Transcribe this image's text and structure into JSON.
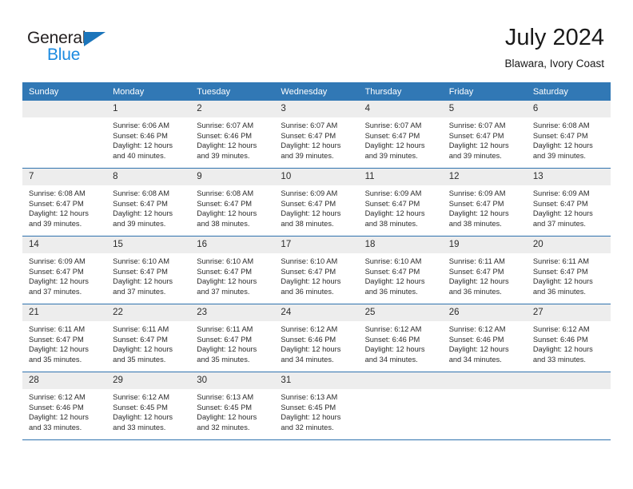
{
  "brand": {
    "name_top": "General",
    "name_bottom": "Blue",
    "color_dark": "#231f20",
    "color_blue": "#1b8ae0",
    "triangle_color": "#1b75bb"
  },
  "header": {
    "month_title": "July 2024",
    "location": "Blawara, Ivory Coast"
  },
  "theme": {
    "header_blue": "#3178b5",
    "rule_blue": "#2f72ae",
    "daynum_bg": "#ededed",
    "text": "#2b2b2b"
  },
  "weekday_headers": [
    "Sunday",
    "Monday",
    "Tuesday",
    "Wednesday",
    "Thursday",
    "Friday",
    "Saturday"
  ],
  "weeks": [
    [
      {
        "day": "",
        "sunrise": "",
        "sunset": "",
        "daylight": ""
      },
      {
        "day": "1",
        "sunrise": "Sunrise: 6:06 AM",
        "sunset": "Sunset: 6:46 PM",
        "daylight": "Daylight: 12 hours and 40 minutes."
      },
      {
        "day": "2",
        "sunrise": "Sunrise: 6:07 AM",
        "sunset": "Sunset: 6:46 PM",
        "daylight": "Daylight: 12 hours and 39 minutes."
      },
      {
        "day": "3",
        "sunrise": "Sunrise: 6:07 AM",
        "sunset": "Sunset: 6:47 PM",
        "daylight": "Daylight: 12 hours and 39 minutes."
      },
      {
        "day": "4",
        "sunrise": "Sunrise: 6:07 AM",
        "sunset": "Sunset: 6:47 PM",
        "daylight": "Daylight: 12 hours and 39 minutes."
      },
      {
        "day": "5",
        "sunrise": "Sunrise: 6:07 AM",
        "sunset": "Sunset: 6:47 PM",
        "daylight": "Daylight: 12 hours and 39 minutes."
      },
      {
        "day": "6",
        "sunrise": "Sunrise: 6:08 AM",
        "sunset": "Sunset: 6:47 PM",
        "daylight": "Daylight: 12 hours and 39 minutes."
      }
    ],
    [
      {
        "day": "7",
        "sunrise": "Sunrise: 6:08 AM",
        "sunset": "Sunset: 6:47 PM",
        "daylight": "Daylight: 12 hours and 39 minutes."
      },
      {
        "day": "8",
        "sunrise": "Sunrise: 6:08 AM",
        "sunset": "Sunset: 6:47 PM",
        "daylight": "Daylight: 12 hours and 39 minutes."
      },
      {
        "day": "9",
        "sunrise": "Sunrise: 6:08 AM",
        "sunset": "Sunset: 6:47 PM",
        "daylight": "Daylight: 12 hours and 38 minutes."
      },
      {
        "day": "10",
        "sunrise": "Sunrise: 6:09 AM",
        "sunset": "Sunset: 6:47 PM",
        "daylight": "Daylight: 12 hours and 38 minutes."
      },
      {
        "day": "11",
        "sunrise": "Sunrise: 6:09 AM",
        "sunset": "Sunset: 6:47 PM",
        "daylight": "Daylight: 12 hours and 38 minutes."
      },
      {
        "day": "12",
        "sunrise": "Sunrise: 6:09 AM",
        "sunset": "Sunset: 6:47 PM",
        "daylight": "Daylight: 12 hours and 38 minutes."
      },
      {
        "day": "13",
        "sunrise": "Sunrise: 6:09 AM",
        "sunset": "Sunset: 6:47 PM",
        "daylight": "Daylight: 12 hours and 37 minutes."
      }
    ],
    [
      {
        "day": "14",
        "sunrise": "Sunrise: 6:09 AM",
        "sunset": "Sunset: 6:47 PM",
        "daylight": "Daylight: 12 hours and 37 minutes."
      },
      {
        "day": "15",
        "sunrise": "Sunrise: 6:10 AM",
        "sunset": "Sunset: 6:47 PM",
        "daylight": "Daylight: 12 hours and 37 minutes."
      },
      {
        "day": "16",
        "sunrise": "Sunrise: 6:10 AM",
        "sunset": "Sunset: 6:47 PM",
        "daylight": "Daylight: 12 hours and 37 minutes."
      },
      {
        "day": "17",
        "sunrise": "Sunrise: 6:10 AM",
        "sunset": "Sunset: 6:47 PM",
        "daylight": "Daylight: 12 hours and 36 minutes."
      },
      {
        "day": "18",
        "sunrise": "Sunrise: 6:10 AM",
        "sunset": "Sunset: 6:47 PM",
        "daylight": "Daylight: 12 hours and 36 minutes."
      },
      {
        "day": "19",
        "sunrise": "Sunrise: 6:11 AM",
        "sunset": "Sunset: 6:47 PM",
        "daylight": "Daylight: 12 hours and 36 minutes."
      },
      {
        "day": "20",
        "sunrise": "Sunrise: 6:11 AM",
        "sunset": "Sunset: 6:47 PM",
        "daylight": "Daylight: 12 hours and 36 minutes."
      }
    ],
    [
      {
        "day": "21",
        "sunrise": "Sunrise: 6:11 AM",
        "sunset": "Sunset: 6:47 PM",
        "daylight": "Daylight: 12 hours and 35 minutes."
      },
      {
        "day": "22",
        "sunrise": "Sunrise: 6:11 AM",
        "sunset": "Sunset: 6:47 PM",
        "daylight": "Daylight: 12 hours and 35 minutes."
      },
      {
        "day": "23",
        "sunrise": "Sunrise: 6:11 AM",
        "sunset": "Sunset: 6:47 PM",
        "daylight": "Daylight: 12 hours and 35 minutes."
      },
      {
        "day": "24",
        "sunrise": "Sunrise: 6:12 AM",
        "sunset": "Sunset: 6:46 PM",
        "daylight": "Daylight: 12 hours and 34 minutes."
      },
      {
        "day": "25",
        "sunrise": "Sunrise: 6:12 AM",
        "sunset": "Sunset: 6:46 PM",
        "daylight": "Daylight: 12 hours and 34 minutes."
      },
      {
        "day": "26",
        "sunrise": "Sunrise: 6:12 AM",
        "sunset": "Sunset: 6:46 PM",
        "daylight": "Daylight: 12 hours and 34 minutes."
      },
      {
        "day": "27",
        "sunrise": "Sunrise: 6:12 AM",
        "sunset": "Sunset: 6:46 PM",
        "daylight": "Daylight: 12 hours and 33 minutes."
      }
    ],
    [
      {
        "day": "28",
        "sunrise": "Sunrise: 6:12 AM",
        "sunset": "Sunset: 6:46 PM",
        "daylight": "Daylight: 12 hours and 33 minutes."
      },
      {
        "day": "29",
        "sunrise": "Sunrise: 6:12 AM",
        "sunset": "Sunset: 6:45 PM",
        "daylight": "Daylight: 12 hours and 33 minutes."
      },
      {
        "day": "30",
        "sunrise": "Sunrise: 6:13 AM",
        "sunset": "Sunset: 6:45 PM",
        "daylight": "Daylight: 12 hours and 32 minutes."
      },
      {
        "day": "31",
        "sunrise": "Sunrise: 6:13 AM",
        "sunset": "Sunset: 6:45 PM",
        "daylight": "Daylight: 12 hours and 32 minutes."
      },
      {
        "day": "",
        "sunrise": "",
        "sunset": "",
        "daylight": ""
      },
      {
        "day": "",
        "sunrise": "",
        "sunset": "",
        "daylight": ""
      },
      {
        "day": "",
        "sunrise": "",
        "sunset": "",
        "daylight": ""
      }
    ]
  ]
}
